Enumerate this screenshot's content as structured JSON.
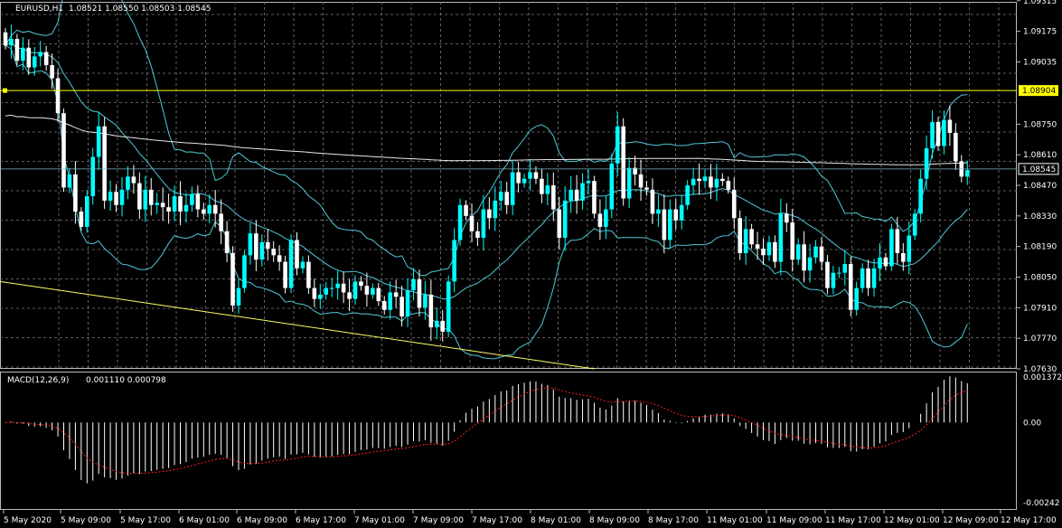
{
  "header": {
    "symbol_label": "EURUSD,H1",
    "ohlc_text": "1.08521 1.08550 1.08503 1.08545"
  },
  "macd": {
    "label": "MACD(12,26,9)",
    "values_text": "0.001110 0.000798",
    "y_ticks": [
      "0.001372",
      "0.00",
      "-0.00242"
    ]
  },
  "colors": {
    "background": "#000000",
    "grid": "#7a7a7a",
    "bull_candle": "#00ffff",
    "bear_candle": "#ffffff",
    "bollinger": "#4fc8d8",
    "slow_ma": "#e8e8e8",
    "horizontal_level": "#ffff00",
    "trendline": "#ffff66",
    "macd_hist": "#ffffff",
    "macd_signal": "#ff2020"
  },
  "chart_data": {
    "type": "candlestick",
    "symbol": "EURUSD",
    "timeframe": "H1",
    "ylim": [
      1.0763,
      1.0931
    ],
    "y_ticks": [
      "1.09315",
      "1.09175",
      "1.09035",
      "1.08750",
      "1.08610",
      "1.08470",
      "1.08330",
      "1.08190",
      "1.08050",
      "1.07910",
      "1.07770",
      "1.07630"
    ],
    "x_ticks": [
      "5 May 2020",
      "5 May 09:00",
      "5 May 17:00",
      "6 May 01:00",
      "6 May 09:00",
      "6 May 17:00",
      "7 May 01:00",
      "7 May 09:00",
      "7 May 17:00",
      "8 May 01:00",
      "8 May 09:00",
      "8 May 17:00",
      "11 May 01:00",
      "11 May 09:00",
      "11 May 17:00",
      "12 May 01:00",
      "12 May 09:00",
      "12 May 17:00"
    ],
    "horizontal_level": 1.08904,
    "horizontal_level_label": "1.08904",
    "current_price": 1.08545,
    "current_price_label": "1.08545",
    "trendline": {
      "from_bar": 0,
      "from_price": 1.0803,
      "to_bar": 101,
      "to_price": 1.0763
    },
    "closes": [
      1.0911,
      1.0914,
      1.0904,
      1.091,
      1.0901,
      1.0906,
      1.0908,
      1.0902,
      1.0896,
      1.088,
      1.0846,
      1.0852,
      1.0835,
      1.0828,
      1.0842,
      1.086,
      1.0874,
      1.084,
      1.0844,
      1.0838,
      1.0845,
      1.0851,
      1.0848,
      1.0836,
      1.0845,
      1.0838,
      1.0839,
      1.0837,
      1.0835,
      1.0842,
      1.0835,
      1.0838,
      1.0843,
      1.0836,
      1.0834,
      1.0838,
      1.0834,
      1.0826,
      1.0816,
      1.0792,
      1.08,
      1.0815,
      1.0825,
      1.0813,
      1.0821,
      1.0818,
      1.0815,
      1.0812,
      1.08,
      1.0822,
      1.0809,
      1.0812,
      1.08,
      1.0795,
      1.0797,
      1.08,
      1.08,
      1.0802,
      1.0798,
      1.0795,
      1.0803,
      1.0801,
      1.0797,
      1.08,
      1.0794,
      1.079,
      1.0798,
      1.0796,
      1.0787,
      1.0799,
      1.0804,
      1.0791,
      1.0797,
      1.0782,
      1.0785,
      1.078,
      1.0803,
      1.0822,
      1.0838,
      1.0833,
      1.0826,
      1.0823,
      1.0836,
      1.0832,
      1.084,
      1.0844,
      1.0838,
      1.0853,
      1.0848,
      1.085,
      1.0853,
      1.085,
      1.0843,
      1.0847,
      1.0836,
      1.0823,
      1.084,
      1.0845,
      1.084,
      1.0848,
      1.0849,
      1.0834,
      1.0828,
      1.0836,
      1.0857,
      1.0874,
      1.0841,
      1.0855,
      1.0852,
      1.0846,
      1.0845,
      1.0834,
      1.0836,
      1.0822,
      1.0836,
      1.0831,
      1.0838,
      1.0847,
      1.085,
      1.0849,
      1.0851,
      1.0846,
      1.085,
      1.0849,
      1.0845,
      1.0832,
      1.0816,
      1.0827,
      1.082,
      1.0818,
      1.0815,
      1.0821,
      1.0812,
      1.0834,
      1.083,
      1.0813,
      1.082,
      1.0808,
      1.0814,
      1.0819,
      1.0812,
      1.08,
      1.0807,
      1.0807,
      1.0811,
      1.079,
      1.08,
      1.0809,
      1.08,
      1.0809,
      1.0814,
      1.081,
      1.0827,
      1.0816,
      1.0812,
      1.0824,
      1.0834,
      1.085,
      1.0864,
      1.0876,
      1.0865,
      1.0877,
      1.0871,
      1.0858,
      1.0851,
      1.0854
    ]
  }
}
